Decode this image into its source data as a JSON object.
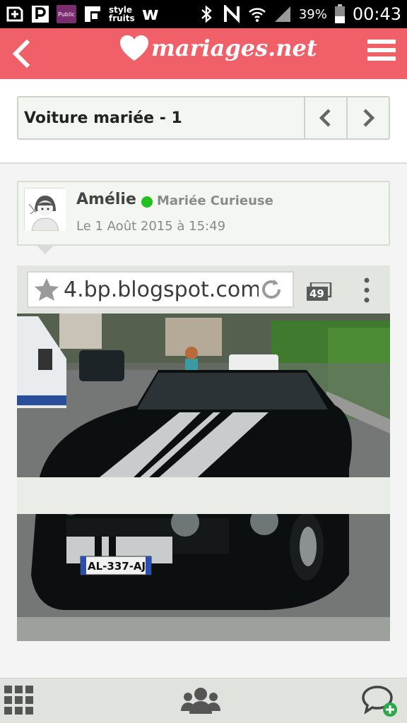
{
  "status_bar": {
    "battery_percent": "39%",
    "time": "00:43",
    "app_icons": [
      "add-box-icon",
      "p-app-icon",
      "public-app-icon",
      "stylefruits-app-icon",
      "w-app-icon"
    ],
    "public_label": "Public",
    "stylefruits_label_1": "style",
    "stylefruits_label_2": "fruits",
    "w_label": "w",
    "system_icons": [
      "bluetooth-icon",
      "nfc-icon",
      "wifi-icon",
      "signal-icon",
      "battery-icon"
    ]
  },
  "app_header": {
    "logo_text": "mariages.net",
    "accent_color": "#ef6068"
  },
  "thread": {
    "title": "Voiture mariée - 1"
  },
  "post": {
    "author_name": "Amélie",
    "author_role": "Mariée Curieuse",
    "online_color": "#22c022",
    "date": "Le 1 Août 2015 à 15:49"
  },
  "photo": {
    "url_text": "4.bp.blogspot.com",
    "tab_count": "49",
    "plate": "AL-337-AJ"
  },
  "bottom_bar": {
    "icons": [
      "grid-menu-icon",
      "community-icon",
      "new-chat-icon"
    ]
  }
}
